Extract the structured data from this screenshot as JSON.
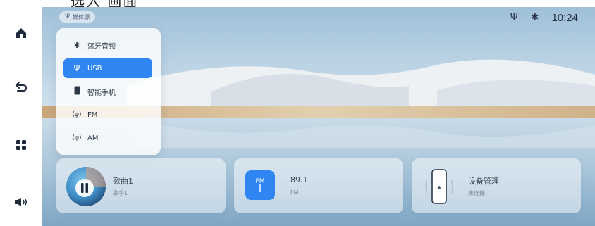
{
  "caption": "选入 画面",
  "sidebar": {
    "items": [
      {
        "name": "home",
        "icon": "home-icon"
      },
      {
        "name": "back",
        "icon": "back-icon"
      },
      {
        "name": "apps",
        "icon": "apps-grid-icon"
      },
      {
        "name": "volume",
        "icon": "volume-icon"
      }
    ]
  },
  "status_bar": {
    "source_chip_label": "媒体源",
    "usb_icon": "usb-icon",
    "bluetooth_icon": "bluetooth-icon",
    "time": "10:24"
  },
  "source_menu": {
    "items": [
      {
        "label": "蓝牙音频",
        "icon": "bluetooth-icon",
        "selected": false
      },
      {
        "label": "USB",
        "icon": "usb-icon",
        "selected": true
      },
      {
        "label": "智能手机",
        "icon": "phone-icon",
        "selected": false
      },
      {
        "label": "FM",
        "icon": "radio-icon",
        "selected": false
      },
      {
        "label": "AM",
        "icon": "radio-icon",
        "selected": false
      }
    ]
  },
  "cards": {
    "music": {
      "title": "歌曲1",
      "subtitle": "歌手1",
      "icon": "pause-icon"
    },
    "radio": {
      "title": "89.1",
      "subtitle": "FM",
      "badge": "FM",
      "icon": "radio-icon"
    },
    "device": {
      "title": "设备管理",
      "subtitle": "未连接",
      "icon": "phone-device-icon"
    }
  },
  "colors": {
    "accent": "#2f86f2",
    "radio_tile": "#2f86f2",
    "sky_top": "#a9c6dc",
    "sky_bottom": "#dfe9f0",
    "dune": "#e9ecef",
    "water": "#8fb4cf"
  }
}
